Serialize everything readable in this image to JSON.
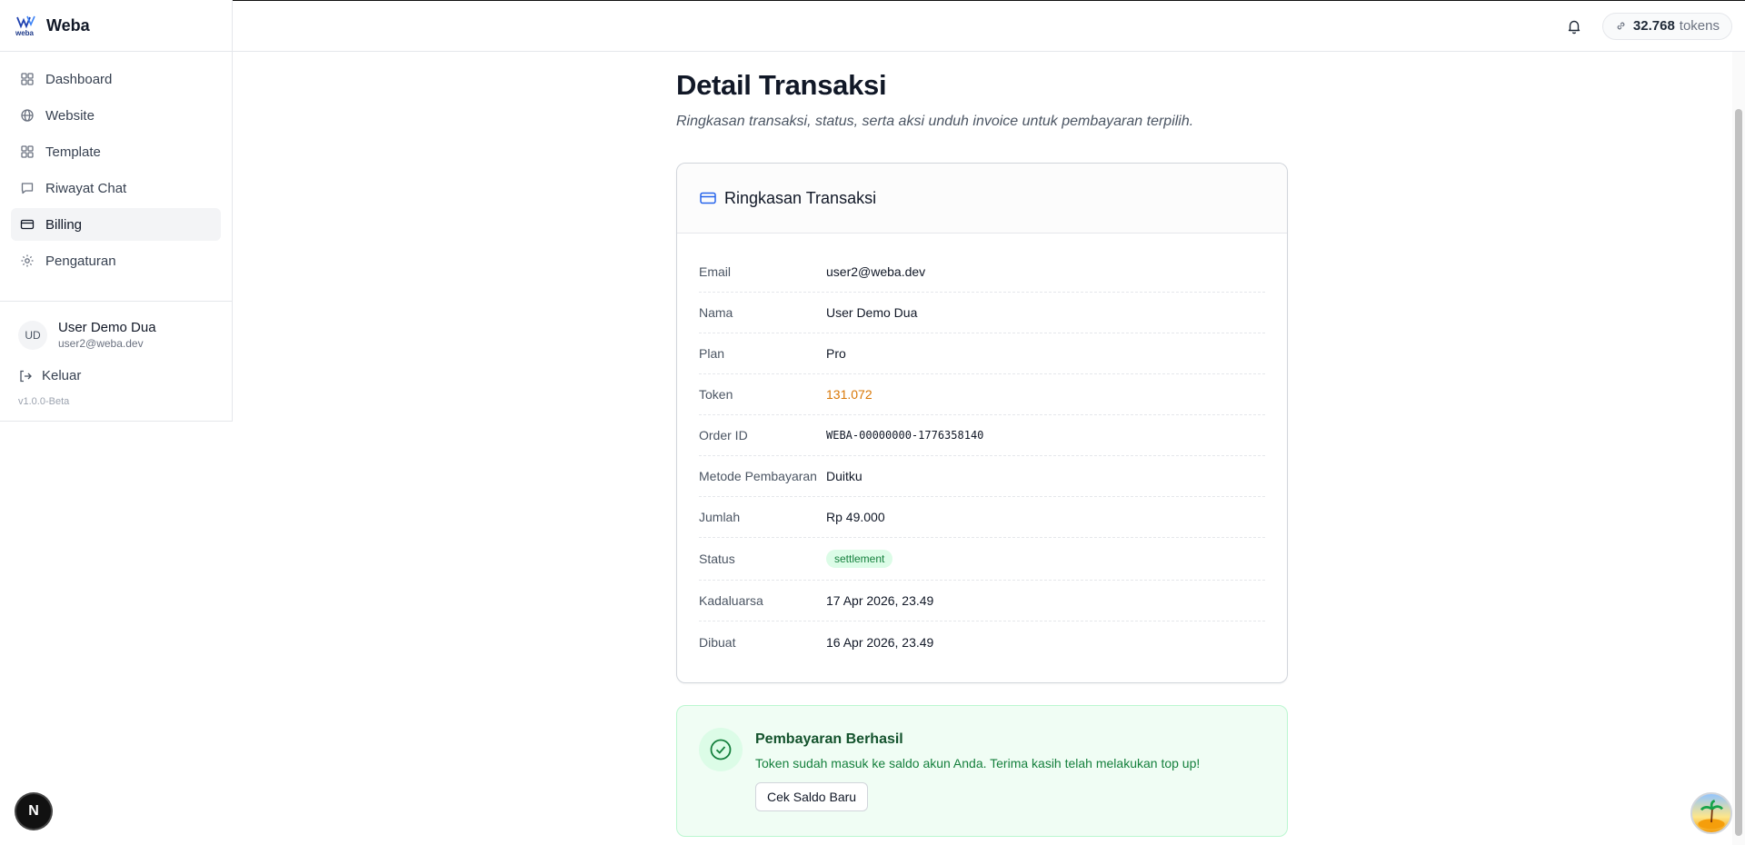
{
  "app": {
    "name": "Weba",
    "logo_text": "weba",
    "version": "v1.0.0-Beta"
  },
  "sidebar": {
    "items": [
      {
        "label": "Dashboard",
        "icon": "grid-icon",
        "active": false
      },
      {
        "label": "Website",
        "icon": "globe-icon",
        "active": false
      },
      {
        "label": "Template",
        "icon": "layout-icon",
        "active": false
      },
      {
        "label": "Riwayat Chat",
        "icon": "message-icon",
        "active": false
      },
      {
        "label": "Billing",
        "icon": "credit-card-icon",
        "active": true
      },
      {
        "label": "Pengaturan",
        "icon": "gear-icon",
        "active": false
      }
    ],
    "user": {
      "initials": "UD",
      "name": "User Demo Dua",
      "email": "user2@weba.dev"
    },
    "logout_label": "Keluar"
  },
  "header": {
    "token_value": "32.768",
    "token_unit": "tokens"
  },
  "page": {
    "title": "Detail Transaksi",
    "subtitle": "Ringkasan transaksi, status, serta aksi unduh invoice untuk pembayaran terpilih."
  },
  "summary": {
    "title": "Ringkasan Transaksi",
    "rows": [
      {
        "label": "Email",
        "value": "user2@weba.dev"
      },
      {
        "label": "Nama",
        "value": "User Demo Dua"
      },
      {
        "label": "Plan",
        "value": "Pro"
      },
      {
        "label": "Token",
        "value": "131.072"
      },
      {
        "label": "Order ID",
        "value": "WEBA-00000000-1776358140"
      },
      {
        "label": "Metode Pembayaran",
        "value": "Duitku"
      },
      {
        "label": "Jumlah",
        "value": "Rp 49.000"
      },
      {
        "label": "Status",
        "value": "settlement"
      },
      {
        "label": "Kadaluarsa",
        "value": "17 Apr 2026, 23.49"
      },
      {
        "label": "Dibuat",
        "value": "16 Apr 2026, 23.49"
      }
    ]
  },
  "success": {
    "title": "Pembayaran Berhasil",
    "text": "Token sudah masuk ke saldo akun Anda. Terima kasih telah melakukan top up!",
    "button_label": "Cek Saldo Baru"
  },
  "overlay": {
    "next_letter": "N"
  },
  "colors": {
    "token": "#d97706",
    "success_bg": "#f0fdf4",
    "badge_bg": "#dcfce7",
    "accent_blue": "#2563eb"
  }
}
